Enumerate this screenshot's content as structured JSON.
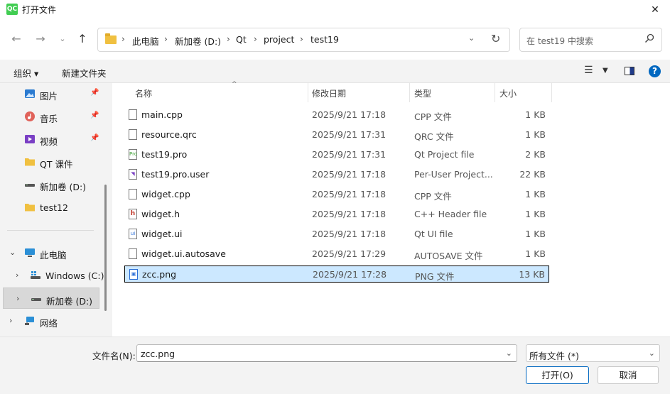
{
  "window": {
    "title": "打开文件",
    "app_icon_text": "QC"
  },
  "nav": {
    "breadcrumb": [
      "此电脑",
      "新加卷 (D:)",
      "Qt",
      "project",
      "test19"
    ],
    "search_placeholder": "在 test19 中搜索"
  },
  "toolbar": {
    "organize_label": "组织 ▾",
    "new_folder_label": "新建文件夹"
  },
  "sidebar": {
    "quick": [
      {
        "label": "图片",
        "pinned": true
      },
      {
        "label": "音乐",
        "pinned": true
      },
      {
        "label": "视频",
        "pinned": true
      },
      {
        "label": "QT 课件",
        "pinned": false
      },
      {
        "label": "新加卷 (D:)",
        "pinned": false
      },
      {
        "label": "test12",
        "pinned": false
      }
    ],
    "tree": [
      {
        "label": "此电脑"
      },
      {
        "label": "Windows (C:)"
      },
      {
        "label": "新加卷 (D:)"
      },
      {
        "label": "网络"
      }
    ]
  },
  "columns": {
    "name": "名称",
    "modified": "修改日期",
    "type": "类型",
    "size": "大小"
  },
  "files": [
    {
      "name": "main.cpp",
      "modified": "2025/9/21 17:18",
      "type": "CPP 文件",
      "size": "1 KB"
    },
    {
      "name": "resource.qrc",
      "modified": "2025/9/21 17:31",
      "type": "QRC 文件",
      "size": "1 KB"
    },
    {
      "name": "test19.pro",
      "modified": "2025/9/21 17:31",
      "type": "Qt Project file",
      "size": "2 KB"
    },
    {
      "name": "test19.pro.user",
      "modified": "2025/9/21 17:18",
      "type": "Per-User Project...",
      "size": "22 KB"
    },
    {
      "name": "widget.cpp",
      "modified": "2025/9/21 17:18",
      "type": "CPP 文件",
      "size": "1 KB"
    },
    {
      "name": "widget.h",
      "modified": "2025/9/21 17:18",
      "type": "C++ Header file",
      "size": "1 KB"
    },
    {
      "name": "widget.ui",
      "modified": "2025/9/21 17:18",
      "type": "Qt UI file",
      "size": "1 KB"
    },
    {
      "name": "widget.ui.autosave",
      "modified": "2025/9/21 17:29",
      "type": "AUTOSAVE 文件",
      "size": "1 KB"
    },
    {
      "name": "zcc.png",
      "modified": "2025/9/21 17:28",
      "type": "PNG 文件",
      "size": "13 KB"
    }
  ],
  "footer": {
    "filename_label": "文件名(N):",
    "filename_value": "zcc.png",
    "filter_value": "所有文件 (*)",
    "open_label": "打开(O)",
    "cancel_label": "取消"
  }
}
